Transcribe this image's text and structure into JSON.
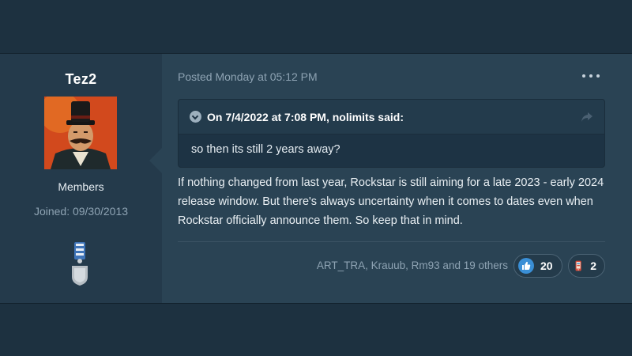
{
  "author": {
    "username": "Tez2",
    "role": "Members",
    "joined": "Joined: 09/30/2013",
    "avatar_icon": "avatar-portrait-icon",
    "badge_icon": "medal-icon"
  },
  "post": {
    "posted_label": "Posted Monday at 05:12 PM",
    "menu_icon": "ellipsis-icon",
    "quote": {
      "cite": "On 7/4/2022 at 7:08 PM, nolimits said:",
      "body": "so then its still 2 years away?"
    },
    "body": "If nothing changed from last year, Rockstar is still aiming for a late 2023 - early 2024 release window. But there's always uncertainty when it comes to dates even when Rockstar officially announce them. So keep that in mind.",
    "reactions": {
      "who": "ART_TRA, Krauub, Rm93 and 19 others",
      "items": [
        {
          "icon": "thumbs-up-icon",
          "count": "20"
        },
        {
          "icon": "phone-icon",
          "count": "2"
        }
      ]
    }
  },
  "colors": {
    "page_bg": "#1d3140",
    "author_bg": "#243a4b",
    "content_bg": "#2a4354",
    "accent": "#3a8fd6"
  }
}
